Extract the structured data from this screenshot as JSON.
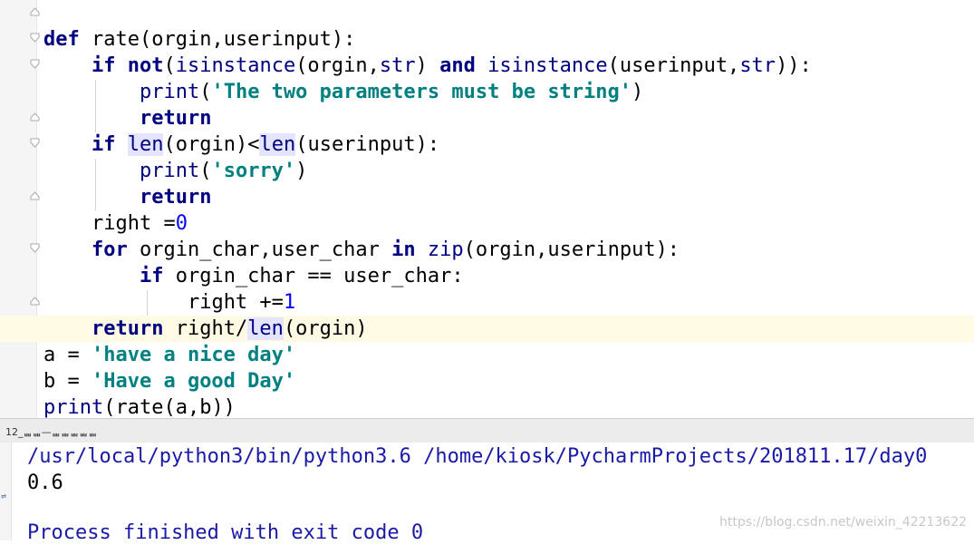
{
  "editor": {
    "docstring_end": "\"\"\"",
    "def_kw": "def",
    "func_sig": " rate(orgin,userinput):",
    "line_if_not": {
      "if": "if",
      "not": "not",
      "open": "(",
      "isinstance1": "isinstance",
      "args1": "(orgin,",
      "str1": "str",
      "close1": ") ",
      "and": "and",
      "sp": " ",
      "isinstance2": "isinstance",
      "args2": "(userinput,",
      "str2": "str",
      "close2": ")):"
    },
    "line_print1": {
      "print": "print",
      "open": "(",
      "string": "'The two parameters must be string'",
      "close": ")"
    },
    "return_kw": "return",
    "line_if_len": {
      "if": "if",
      "len1": "len",
      "args1": "(orgin)<",
      "len2": "len",
      "args2": "(userinput):"
    },
    "line_print2": {
      "print": "print",
      "open": "(",
      "string": "'sorry'",
      "close": ")"
    },
    "line_right_init": {
      "text": "right =",
      "num": "0"
    },
    "line_for": {
      "for": "for",
      "vars": " orgin_char,user_char ",
      "in": "in",
      "sp": " ",
      "zip": "zip",
      "args": "(orgin,userinput):"
    },
    "line_if_eq": {
      "if": "if",
      "cond": " orgin_char == user_char:"
    },
    "line_right_inc": {
      "text": "right +=",
      "num": "1"
    },
    "line_return_final": {
      "return": "return",
      "expr": " right/",
      "len": "len",
      "args": "(orgin)"
    },
    "line_a": {
      "text": "a = ",
      "string": "'have a nice day'"
    },
    "line_b": {
      "text": "b = ",
      "string": "'Have a good Day'"
    },
    "line_print3": {
      "print": "print",
      "args": "(rate(a,b))"
    }
  },
  "run_panel": {
    "tab_label": "12_ᆸᆸᆸᆸ—ᆸᆸᆸᆸᆸᆸᆸᆸᆸᆸ"
  },
  "console": {
    "command": "/usr/local/python3/bin/python3.6 /home/kiosk/PycharmProjects/201811.17/day0",
    "output": "0.6",
    "exit_message": "Process finished with exit code 0"
  },
  "watermark": "https://blog.csdn.net/weixin_42213622",
  "colors": {
    "keyword": "#000080",
    "string": "#008080",
    "number": "#0000ff",
    "current_line": "#fffae3",
    "console_command": "#1a1aa6"
  }
}
